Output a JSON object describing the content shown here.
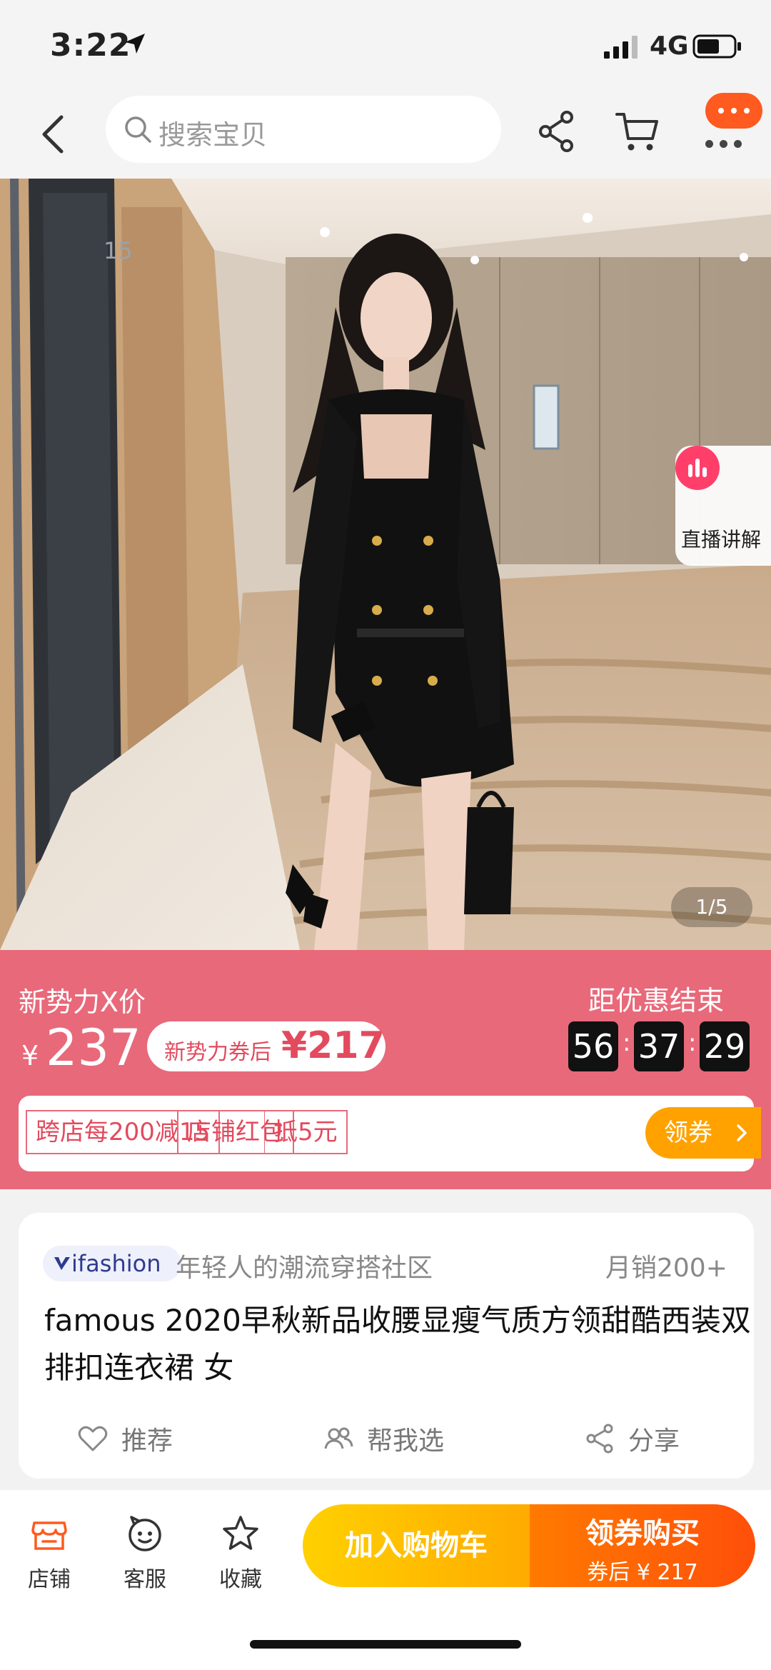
{
  "status_bar": {
    "time": "3:22",
    "network": "4G"
  },
  "nav": {
    "search_placeholder": "搜索宝贝"
  },
  "hero": {
    "live_label": "直播讲解",
    "image_counter": "1/5"
  },
  "promo": {
    "title": "新势力X价",
    "currency": "¥",
    "price": "237",
    "coupon_label": "新势力券后",
    "coupon_price": "¥217",
    "countdown_label": "距优惠结束",
    "countdown": {
      "hours": "56",
      "minutes": "37",
      "seconds": "29"
    },
    "tags": [
      "跨店每200减15",
      "店铺红包",
      "抵5元"
    ],
    "claim_label": "领券"
  },
  "product": {
    "brand": "ifashion",
    "brand_slogan": "年轻人的潮流穿搭社区",
    "sales": "月销200+",
    "title": "famous  2020早秋新品收腰显瘦气质方领甜酷西装双排扣连衣裙 女",
    "actions": {
      "recommend": "推荐",
      "help_choose": "帮我选",
      "share": "分享"
    }
  },
  "bottom_bar": {
    "tabs": {
      "shop": "店铺",
      "service": "客服",
      "favorite": "收藏"
    },
    "add_to_cart": "加入购物车",
    "buy_label": "领券购买",
    "buy_sub": "券后 ¥ 217"
  },
  "colors": {
    "brand_orange": "#ff5a1f",
    "promo_bg": "#e8697a",
    "price_red": "#e34a5e"
  },
  "icons": [
    "location-arrow-icon",
    "signal-icon",
    "battery-icon",
    "back-arrow-icon",
    "search-icon",
    "share-icon",
    "cart-icon",
    "more-icon",
    "live-icon",
    "chevron-right-icon",
    "ifashion-logo-icon",
    "heart-icon",
    "people-icon",
    "share-icon",
    "shop-icon",
    "service-icon",
    "star-icon"
  ]
}
